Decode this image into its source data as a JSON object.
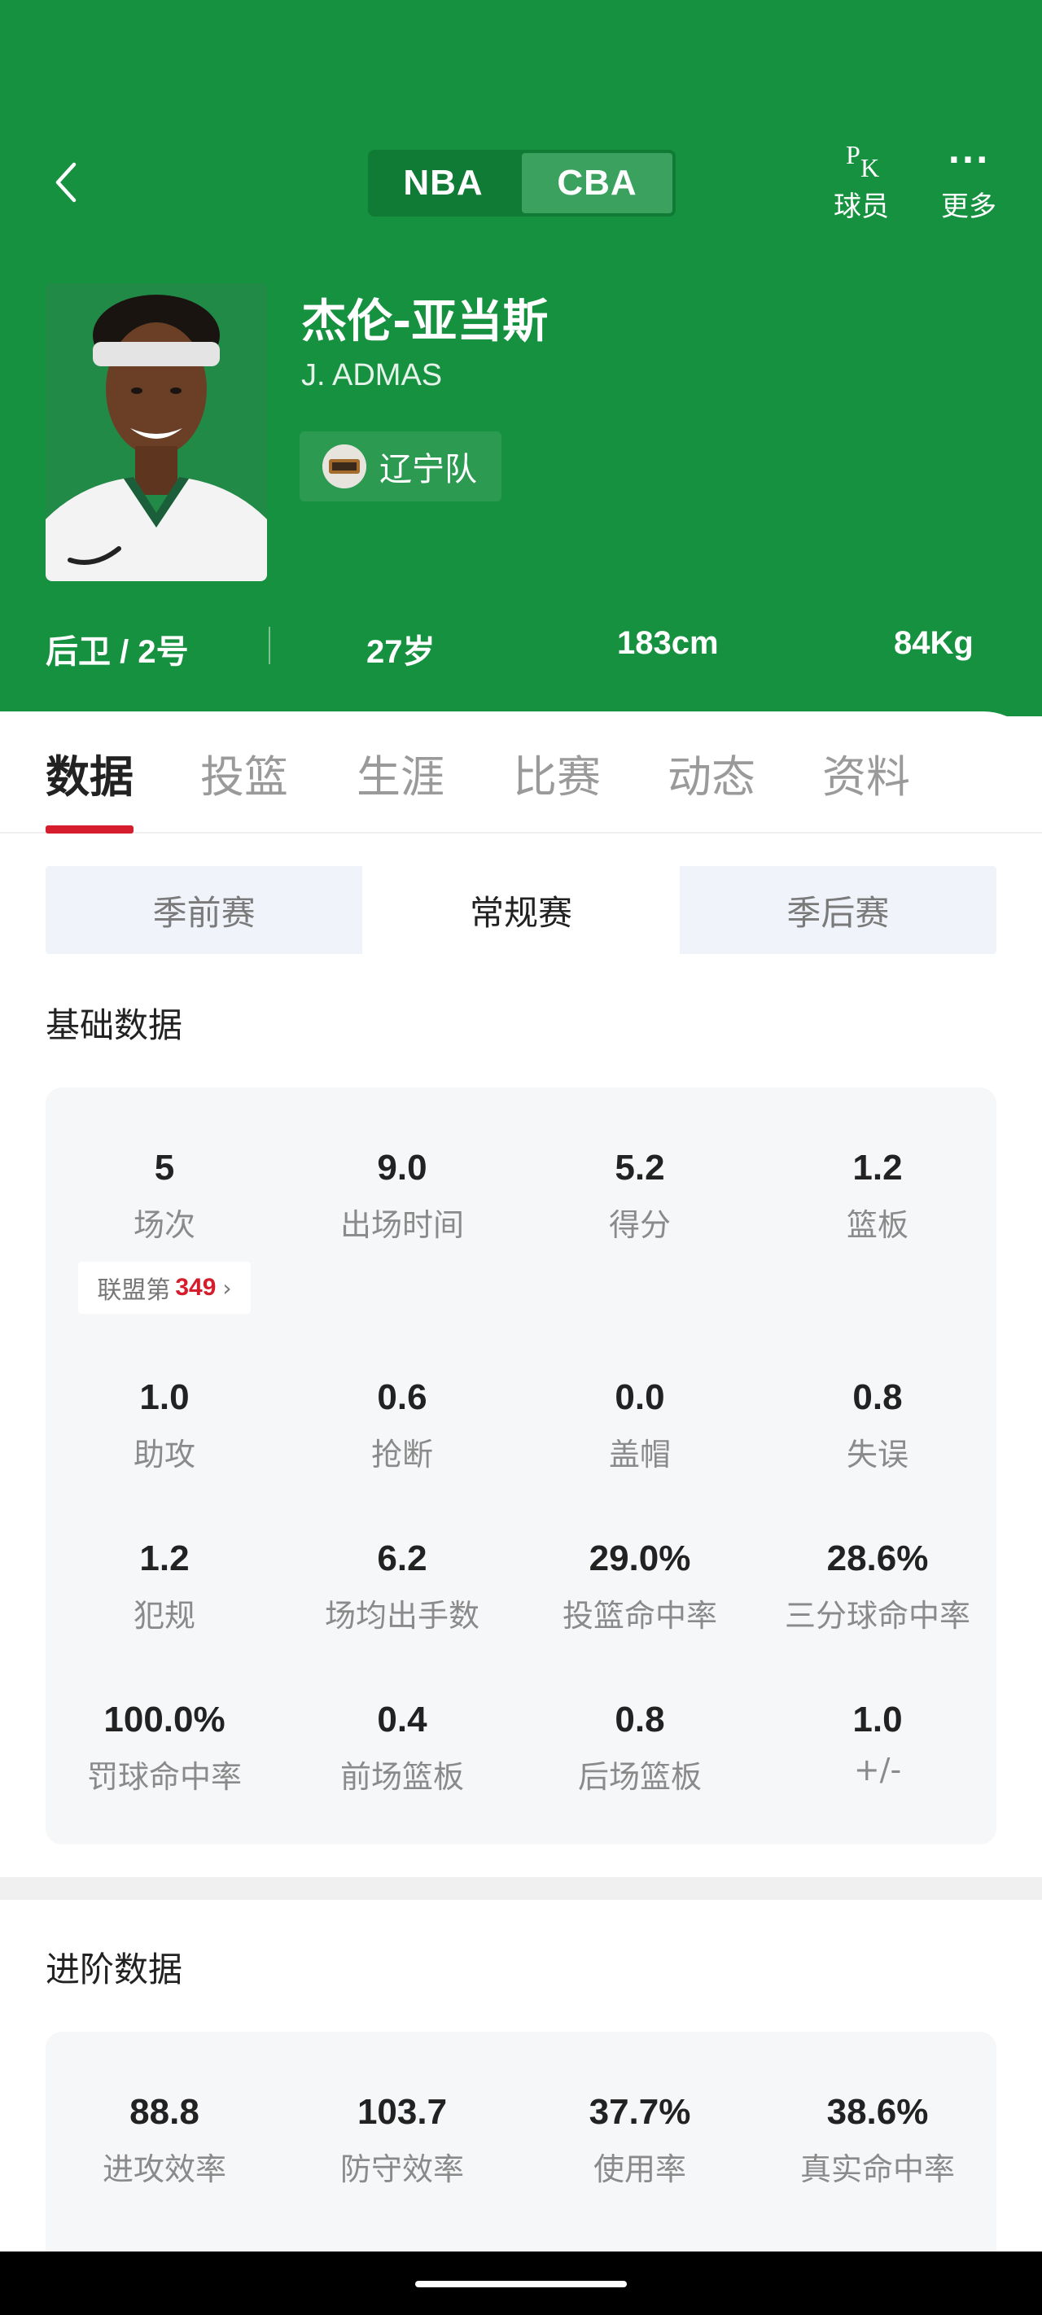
{
  "header": {
    "league_tabs": [
      "NBA",
      "CBA"
    ],
    "active_league": "CBA",
    "actions": [
      {
        "label": "球员",
        "icon": "pk-icon",
        "icon_text_main": "P",
        "icon_text_sub": "K"
      },
      {
        "label": "更多",
        "icon": "more-icon",
        "icon_text": "···"
      }
    ]
  },
  "player": {
    "name_cn": "杰伦-亚当斯",
    "name_en": "J. ADMAS",
    "team": "辽宁队",
    "position": "后卫 / 2号",
    "age": "27岁",
    "height": "183cm",
    "weight": "84Kg"
  },
  "tabs": [
    "数据",
    "投篮",
    "生涯",
    "比赛",
    "动态",
    "资料"
  ],
  "active_tab": "数据",
  "season_types": [
    "季前赛",
    "常规赛",
    "季后赛"
  ],
  "active_season_type": "常规赛",
  "basic": {
    "title": "基础数据",
    "stats": [
      {
        "value": "5",
        "label": "场次"
      },
      {
        "value": "9.0",
        "label": "出场时间"
      },
      {
        "value": "5.2",
        "label": "得分"
      },
      {
        "value": "1.2",
        "label": "篮板"
      },
      {
        "value": "1.0",
        "label": "助攻"
      },
      {
        "value": "0.6",
        "label": "抢断"
      },
      {
        "value": "0.0",
        "label": "盖帽"
      },
      {
        "value": "0.8",
        "label": "失误"
      },
      {
        "value": "1.2",
        "label": "犯规"
      },
      {
        "value": "6.2",
        "label": "场均出手数"
      },
      {
        "value": "29.0%",
        "label": "投篮命中率"
      },
      {
        "value": "28.6%",
        "label": "三分球命中率"
      },
      {
        "value": "100.0%",
        "label": "罚球命中率"
      },
      {
        "value": "0.4",
        "label": "前场篮板"
      },
      {
        "value": "0.8",
        "label": "后场篮板"
      },
      {
        "value": "1.0",
        "label": "+/-"
      }
    ],
    "rank_prefix": "联盟第",
    "rank_value": "349"
  },
  "advanced": {
    "title": "进阶数据",
    "stats": [
      {
        "value": "88.8",
        "label": "进攻效率"
      },
      {
        "value": "103.7",
        "label": "防守效率"
      },
      {
        "value": "37.7%",
        "label": "使用率"
      },
      {
        "value": "38.6%",
        "label": "真实命中率"
      }
    ]
  },
  "colors": {
    "header_green": "#16913f",
    "accent_red": "#d51d2d",
    "card_bg": "#f6f7f9"
  }
}
